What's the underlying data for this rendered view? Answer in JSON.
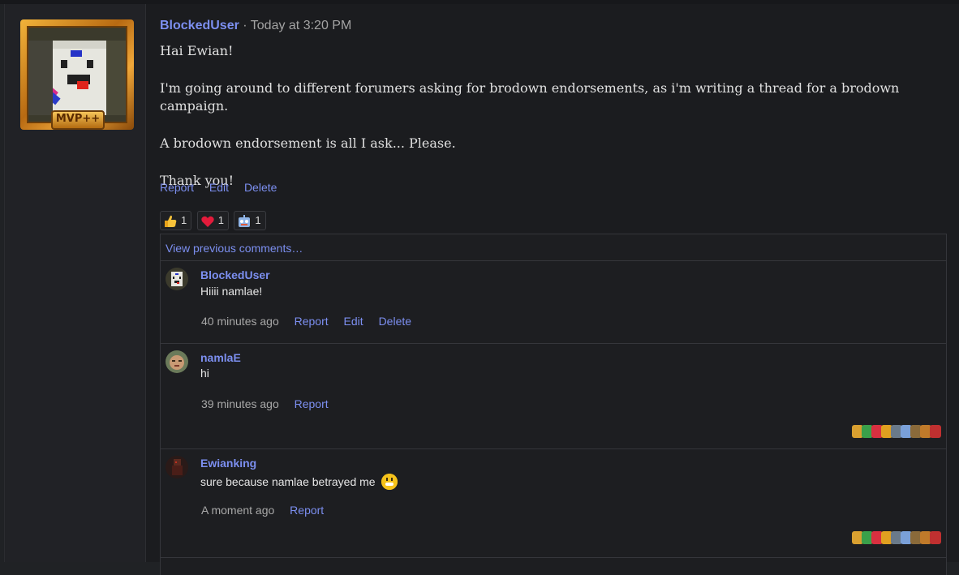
{
  "post": {
    "author": "BlockedUser",
    "separator": "·",
    "timestamp": "Today at 3:20 PM",
    "badge": "MVP++",
    "paragraphs": [
      "Hai Ewian!",
      "I'm going around to different forumers asking for brodown endorsements, as i'm writing a thread for a brodown campaign.",
      "A brodown endorsement is all I ask... Please.",
      "Thank you!"
    ],
    "actions": {
      "report": "Report",
      "edit": "Edit",
      "delete": "Delete"
    },
    "reactions": [
      {
        "icon": "thumbs-up-icon",
        "count": "1"
      },
      {
        "icon": "heart-icon",
        "count": "1"
      },
      {
        "icon": "robot-face-icon",
        "count": "1"
      }
    ]
  },
  "comments_section": {
    "view_previous": "View previous comments…",
    "comments": [
      {
        "author": "BlockedUser",
        "text": "Hiiii namlae!",
        "time": "40 minutes ago",
        "report": "Report",
        "edit": "Edit",
        "delete": "Delete"
      },
      {
        "author": "namlaE",
        "text": "hi",
        "time": "39 minutes ago",
        "report": "Report"
      },
      {
        "author": "Ewianking",
        "text": "sure because namlae betrayed me",
        "emoji": "grinning-face-icon",
        "time": "A moment ago",
        "report": "Report"
      }
    ]
  },
  "colors": {
    "link": "#7c8ff0",
    "background": "#1b1c1f",
    "sidebar": "#212226",
    "gold": "#f2b33a"
  }
}
